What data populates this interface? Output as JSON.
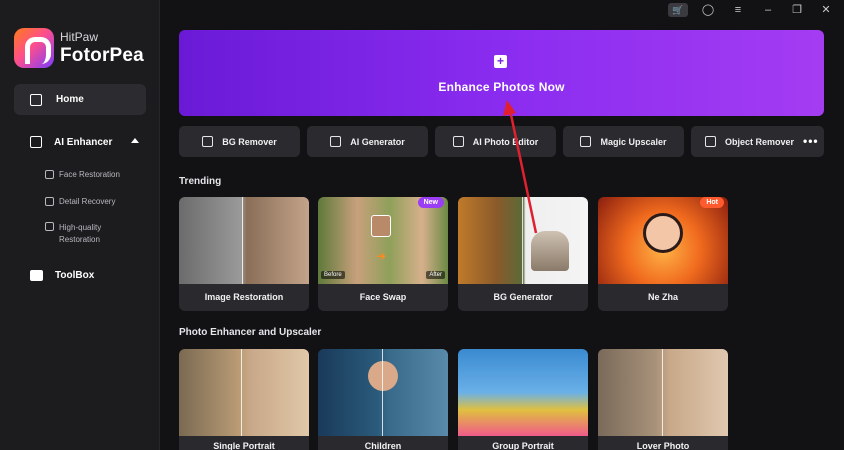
{
  "brand": {
    "sub": "HitPaw",
    "name": "FotorPea"
  },
  "sidebar": {
    "home": "Home",
    "ai_enhancer": "AI Enhancer",
    "sub_items": [
      "Face Restoration",
      "Detail Recovery",
      "High-quality",
      "Restoration"
    ],
    "toolbox": "ToolBox"
  },
  "banner": {
    "label": "Enhance Photos Now"
  },
  "tools": [
    "BG Remover",
    "AI Generator",
    "AI Photo Editor",
    "Magic Upscaler",
    "Object Remover"
  ],
  "more": "•••",
  "sections": {
    "trending": "Trending",
    "enhancer": "Photo Enhancer and Upscaler"
  },
  "trending": [
    {
      "label": "Image Restoration"
    },
    {
      "label": "Face Swap",
      "badge": "New",
      "before": "Before",
      "after": "After"
    },
    {
      "label": "BG Generator"
    },
    {
      "label": "Ne Zha",
      "badge": "Hot"
    }
  ],
  "enhancer": [
    {
      "label": "Single Portrait"
    },
    {
      "label": "Children"
    },
    {
      "label": "Group Portrait"
    },
    {
      "label": "Lover Photo"
    }
  ],
  "colors": {
    "accent": "#8a2cf0",
    "bg": "#121214",
    "sidebar": "#1c1c1f",
    "arrow": "#e0202f"
  }
}
